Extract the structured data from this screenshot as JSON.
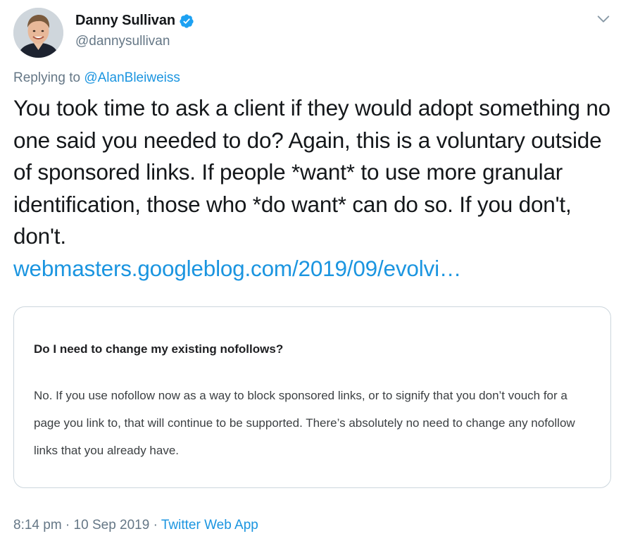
{
  "author": {
    "display_name": "Danny Sullivan",
    "handle": "@dannysullivan",
    "verified": true
  },
  "icons": {
    "verified": "verified-badge-icon",
    "menu": "chevron-down-icon"
  },
  "reply": {
    "prefix": "Replying to ",
    "to_handle": "@AlanBleiweiss"
  },
  "tweet": {
    "text": "You took time to ask a client if they would adopt something no one said you needed to do? Again, this is a voluntary outside of sponsored links. If people *want* to use more granular identification, those who *do want* can do so. If you don't, don't.",
    "link": "webmasters.googleblog.com/2019/09/evolvi…"
  },
  "card": {
    "heading": "Do I need to change my existing nofollows?",
    "body": "No. If you use nofollow now as a way to block sponsored links, or to signify that you don’t vouch for a page you link to, that will continue to be supported. There’s absolutely no need to change any nofollow links that you already have."
  },
  "meta": {
    "time": "8:14 pm",
    "separator1": " · ",
    "date": "10 Sep 2019",
    "separator2": " · ",
    "source": "Twitter Web App"
  },
  "colors": {
    "link": "#1b95e0",
    "secondary_text": "#657786",
    "border": "#ccd6dd"
  }
}
